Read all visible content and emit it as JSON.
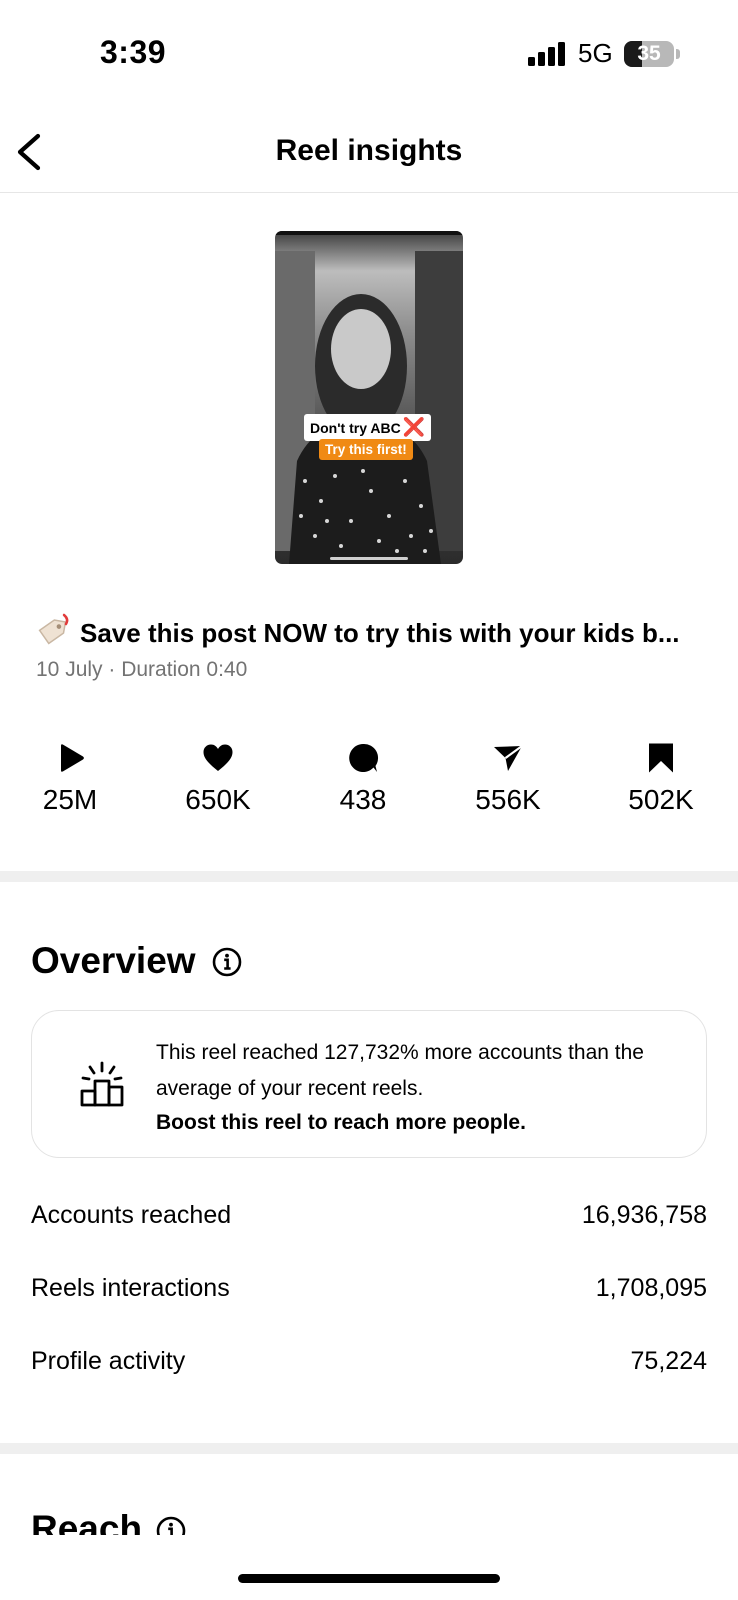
{
  "status_bar": {
    "time": "3:39",
    "network": "5G",
    "battery": "35",
    "battery_level": 0.35
  },
  "header": {
    "title": "Reel insights",
    "back_icon": "chevron-left-icon"
  },
  "reel": {
    "thumbnail": {
      "sticker_line1": "Don't try ABC",
      "sticker_mark": "❌",
      "sticker_line2": "Try this first!"
    },
    "caption": "Save this post NOW to try this with your kids b...",
    "meta": "10 July · Duration 0:40"
  },
  "stats": [
    {
      "icon": "play-icon",
      "value": "25M"
    },
    {
      "icon": "heart-icon",
      "value": "650K"
    },
    {
      "icon": "comment-icon",
      "value": "438"
    },
    {
      "icon": "share-icon",
      "value": "556K"
    },
    {
      "icon": "bookmark-icon",
      "value": "502K"
    }
  ],
  "overview": {
    "title": "Overview",
    "card_text": "This reel reached 127,732% more accounts than the average of your recent reels.",
    "card_cta": "Boost this reel to reach more people.",
    "rows": [
      {
        "label": "Accounts reached",
        "value": "16,936,758"
      },
      {
        "label": "Reels interactions",
        "value": "1,708,095"
      },
      {
        "label": "Profile activity",
        "value": "75,224"
      }
    ]
  },
  "reach": {
    "title": "Reach"
  }
}
